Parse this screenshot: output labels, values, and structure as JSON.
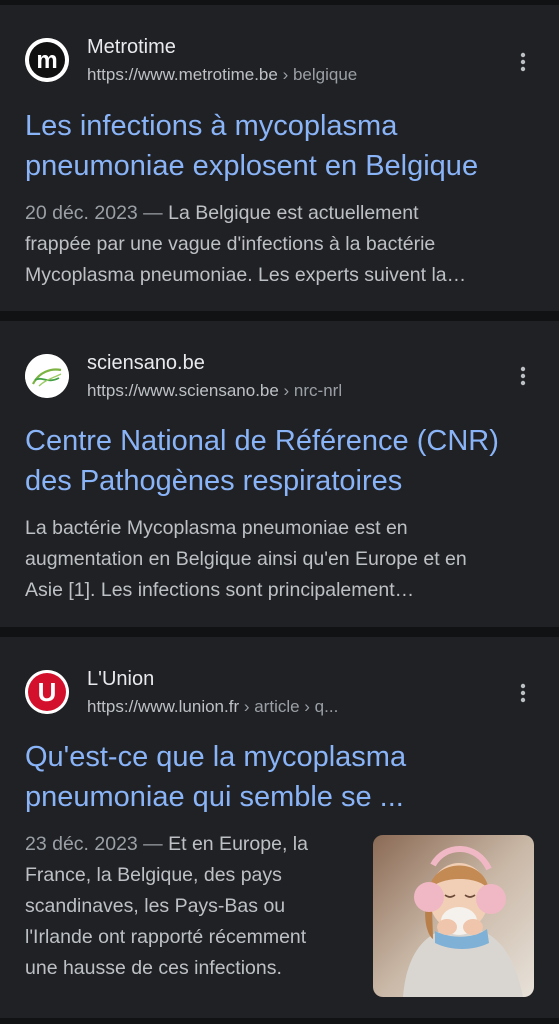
{
  "results": [
    {
      "site_name": "Metrotime",
      "url_base": "https://www.metrotime.be",
      "url_path": " › belgique",
      "title_line1": "Les infections à mycoplasma",
      "title_line2": "pneumoniae explosent en Belgique",
      "date": "20 déc. 2023 — ",
      "snippet_line1_rest": "La Belgique est actuellement",
      "snippet_line2": "frappée par une vague d'infections à la bactérie",
      "snippet_line3": "Mycoplasma pneumoniae. Les experts suivent la…",
      "favicon_icon": "metrotime-logo-icon"
    },
    {
      "site_name": "sciensano.be",
      "url_base": "https://www.sciensano.be",
      "url_path": " › nrc-nrl",
      "title_line1": "Centre National de Référence (CNR)",
      "title_line2": "des Pathogènes respiratoires",
      "snippet_line1": "La bactérie Mycoplasma pneumoniae est en",
      "snippet_line2": "augmentation en Belgique ainsi qu'en Europe et en",
      "snippet_line3": "Asie [1]. Les infections sont principalement…",
      "favicon_icon": "sciensano-logo-icon"
    },
    {
      "site_name": "L'Union",
      "url_base": "https://www.lunion.fr",
      "url_path": " › article › q...",
      "title_line1": "Qu'est-ce que la mycoplasma",
      "title_line2": "pneumoniae qui semble se ...",
      "date": "23 déc. 2023 — ",
      "snippet_line1_rest": "Et en Europe, la",
      "snippet_line2": "France, la Belgique, des pays",
      "snippet_line3": "scandinaves, les Pays-Bas ou",
      "snippet_line4": "l'Irlande ont rapporté récemment",
      "snippet_line5": "une hausse de ces infections.",
      "favicon_icon": "lunion-logo-icon",
      "thumbnail_letter": "U"
    }
  ],
  "colors": {
    "background": "#111214",
    "card": "#202124",
    "title_link": "#8ab4f8",
    "site_name": "#e8eaed",
    "snippet": "#bdc1c6",
    "lunion_red": "#d3112c"
  },
  "icons": {
    "more": "more-vert-icon"
  }
}
